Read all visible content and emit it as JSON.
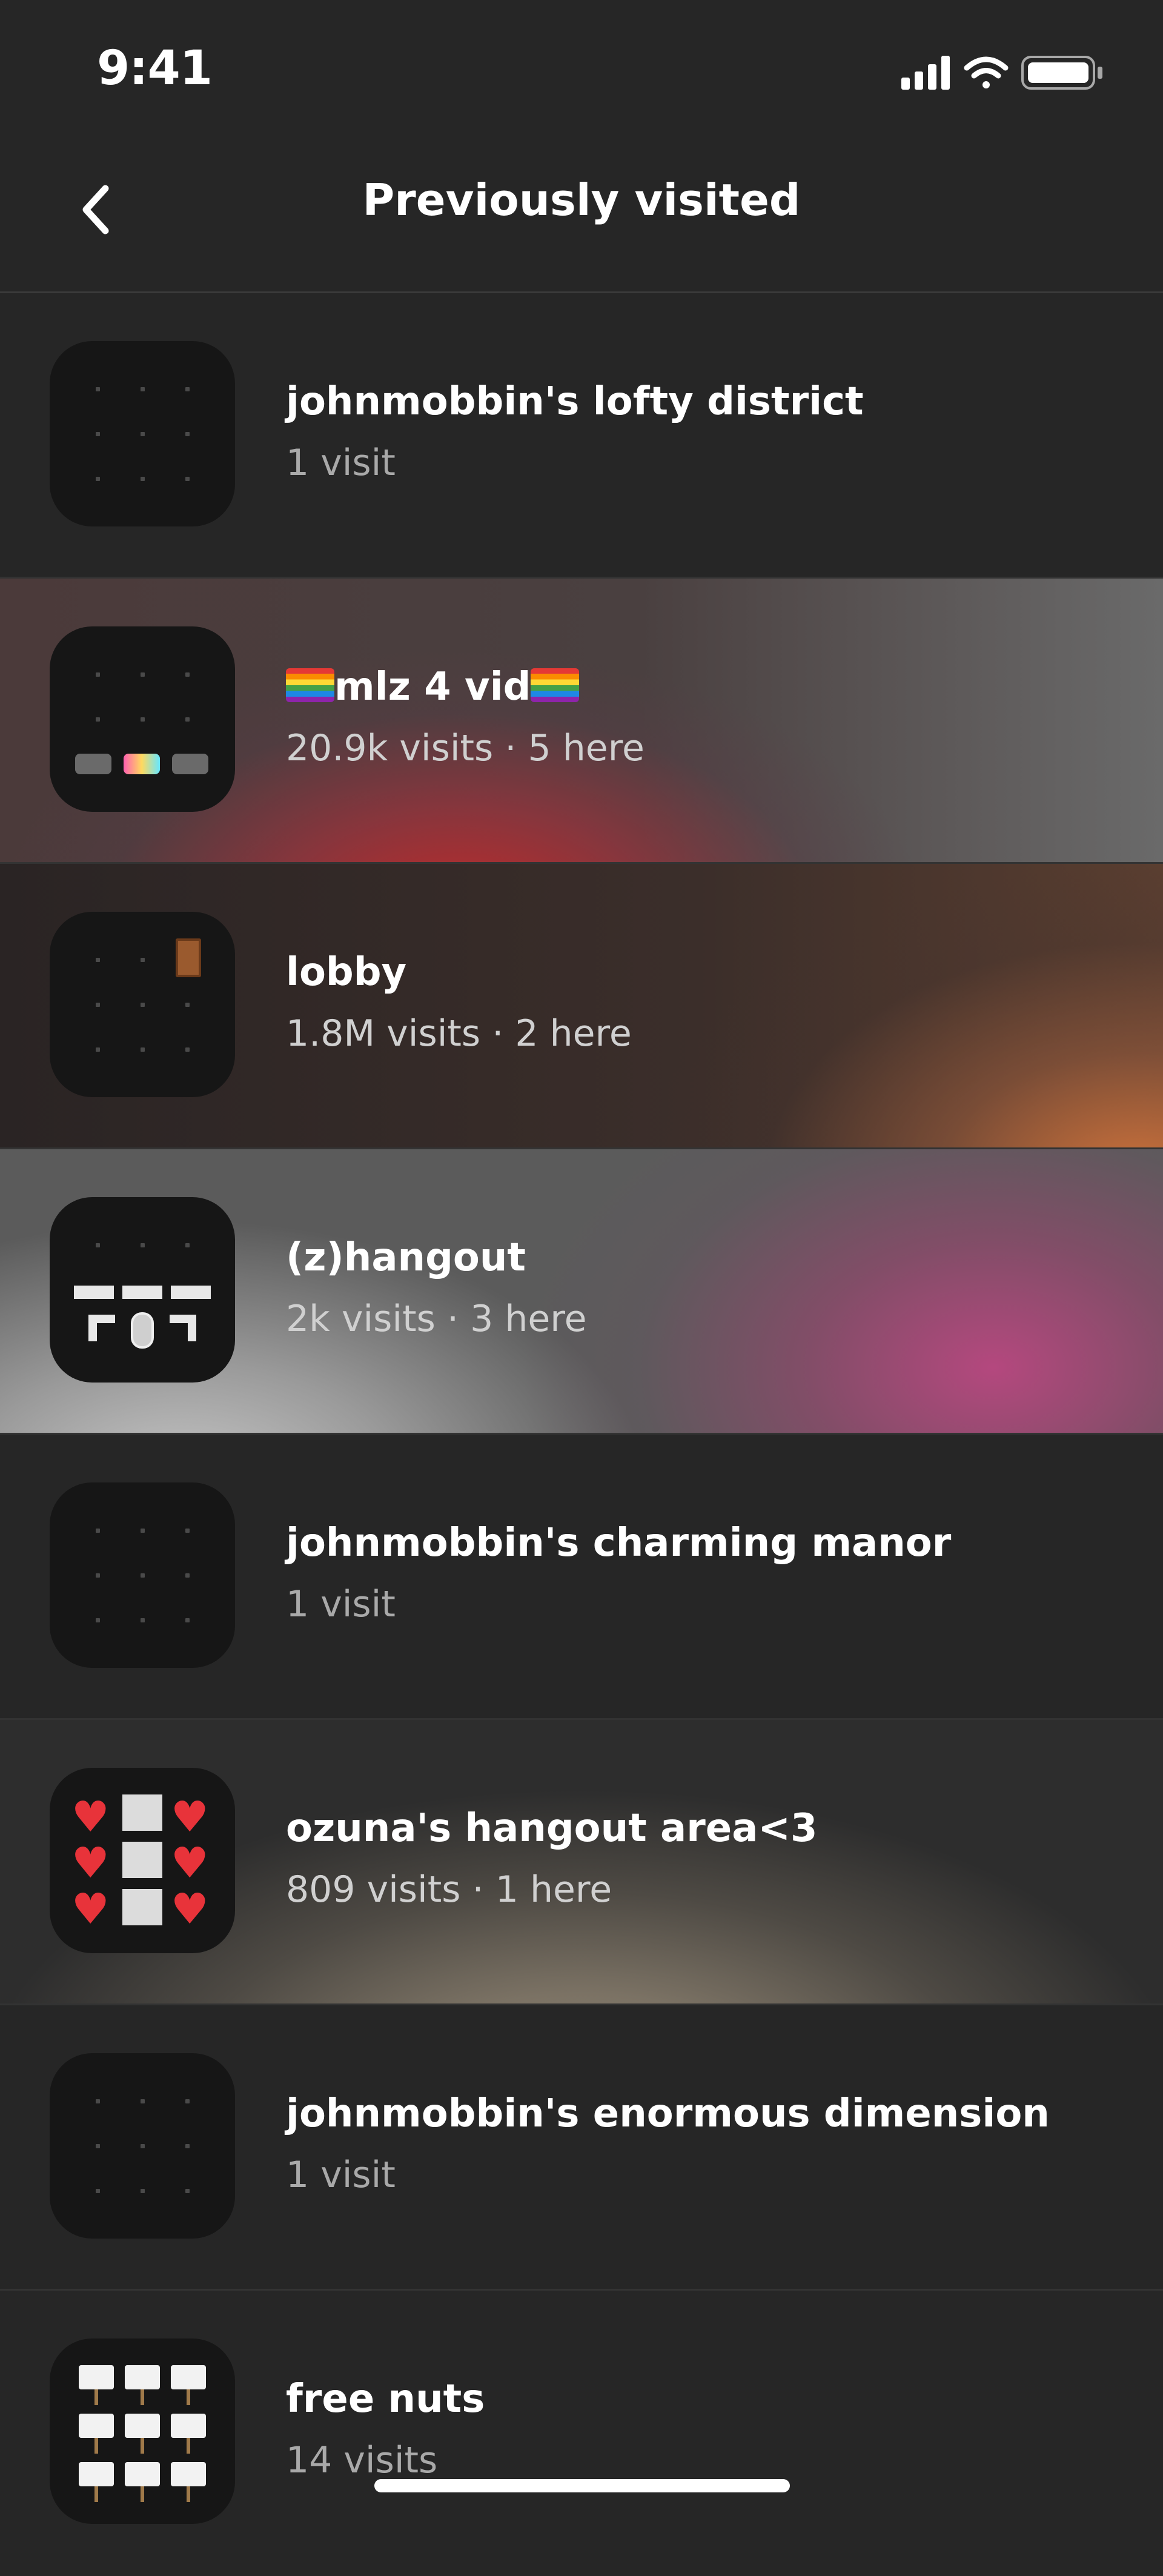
{
  "status_bar": {
    "time": "9:41",
    "icons": [
      "signal-icon",
      "wifi-icon",
      "battery-icon"
    ]
  },
  "nav": {
    "back_icon": "chevron-left-icon",
    "title": "Previously visited"
  },
  "rooms": [
    {
      "name": "johnmobbin's lofty district",
      "stats": "1 visit",
      "thumbnail": "dot-grid"
    },
    {
      "name": "mlz 4 vid",
      "name_prefix_icon": "rainbow-flag-icon",
      "name_suffix_icon": "rainbow-flag-icon",
      "stats": "20.9k visits · 5 here",
      "thumbnail": "sofas"
    },
    {
      "name": "lobby",
      "stats": "1.8M visits · 2 here",
      "thumbnail": "door"
    },
    {
      "name": "(z)hangout",
      "stats": "2k visits · 3 here",
      "thumbnail": "microphone-stage"
    },
    {
      "name": "johnmobbin's charming manor",
      "stats": "1 visit",
      "thumbnail": "dot-grid"
    },
    {
      "name": "ozuna's hangout area<3",
      "stats": "809 visits · 1 here",
      "thumbnail": "hearts"
    },
    {
      "name": "johnmobbin's enormous dimension",
      "stats": "1 visit",
      "thumbnail": "dot-grid"
    },
    {
      "name": "free nuts",
      "stats": "14 visits",
      "thumbnail": "signs"
    }
  ],
  "colors": {
    "background": "#262626",
    "thumbnail_bg": "#161616",
    "subtitle": "#a9a9a9",
    "heart": "#e8333a"
  }
}
